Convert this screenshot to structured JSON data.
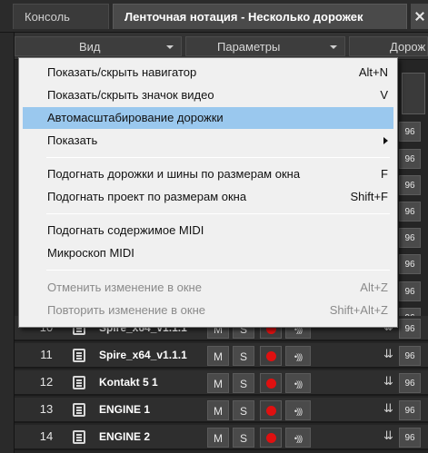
{
  "tabs": [
    {
      "label": "Консоль"
    },
    {
      "label": "Ленточная нотация - Несколько дорожек"
    }
  ],
  "menubar": {
    "view": "Вид",
    "params": "Параметры",
    "tracks": "Дорож"
  },
  "menu": {
    "items": [
      {
        "label": "Показать/скрыть навигатор",
        "shortcut": "Alt+N"
      },
      {
        "label": "Показать/скрыть значок видео",
        "shortcut": "V"
      },
      {
        "label": "Автомасштабирование дорожки",
        "shortcut": ""
      },
      {
        "label": "Показать",
        "shortcut": ""
      },
      {
        "label": "Подогнать дорожки и шины по размерам окна",
        "shortcut": "F"
      },
      {
        "label": "Подогнать проект по размерам окна",
        "shortcut": "Shift+F"
      },
      {
        "label": "Подогнать содержимое MIDI",
        "shortcut": ""
      },
      {
        "label": "Микроскоп MIDI",
        "shortcut": ""
      },
      {
        "label": "Отменить изменение в окне",
        "shortcut": "Alt+Z"
      },
      {
        "label": "Повторить изменение в окне",
        "shortcut": "Shift+Alt+Z"
      }
    ]
  },
  "tracks": {
    "rows": [
      {
        "num": "10",
        "name": "Spire_x64_v1.1.1",
        "m": "M",
        "s": "S",
        "monitor": "•)))",
        "value": "96"
      },
      {
        "num": "11",
        "name": "Spire_x64_v1.1.1",
        "m": "M",
        "s": "S",
        "monitor": "•)))",
        "value": "96"
      },
      {
        "num": "12",
        "name": "Kontakt 5 1",
        "m": "M",
        "s": "S",
        "monitor": "•)))",
        "value": "96"
      },
      {
        "num": "13",
        "name": "ENGINE 1",
        "m": "M",
        "s": "S",
        "monitor": "•)))",
        "value": "96"
      },
      {
        "num": "14",
        "name": "ENGINE 2",
        "m": "M",
        "s": "S",
        "monitor": "•)))",
        "value": "96"
      }
    ],
    "drop_glyph": "⇊",
    "column_values": [
      "96",
      "96",
      "96",
      "96",
      "96",
      "96",
      "96",
      "96",
      "96",
      "96",
      "96"
    ]
  }
}
